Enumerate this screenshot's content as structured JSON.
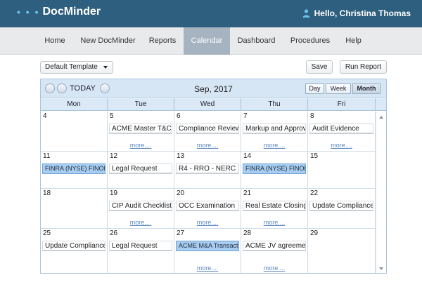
{
  "app": {
    "logo_dots": "• • •",
    "name": "DocMinder",
    "greeting": "Hello, Christina Thomas"
  },
  "nav": [
    "Home",
    "New DocMinder",
    "Reports",
    "Calendar",
    "Dashboard",
    "Procedures",
    "Help"
  ],
  "nav_active": "Calendar",
  "toolbar": {
    "template": "Default Template",
    "save": "Save",
    "run_report": "Run Report"
  },
  "calendar": {
    "today_label": "TODAY",
    "title": "Sep, 2017",
    "views": [
      "Day",
      "Week",
      "Month"
    ],
    "active_view": "Month",
    "weekdays": [
      "Mon",
      "Tue",
      "Wed",
      "Thu",
      "Fri"
    ],
    "more_label": "more....",
    "weeks": [
      [
        {
          "day": "4"
        },
        {
          "day": "5",
          "event": "ACME Master T&C",
          "more": true
        },
        {
          "day": "6",
          "event": "Compliance Review",
          "more": true
        },
        {
          "day": "7",
          "event": "Markup and Approval",
          "more": true
        },
        {
          "day": "8",
          "event": "Audit Evidence",
          "more": true
        }
      ],
      [
        {
          "day": "11",
          "event": "FINRA (NYSE) FINOP",
          "highlight": true
        },
        {
          "day": "12",
          "event": "Legal Request"
        },
        {
          "day": "13",
          "event": "R4 - RRO - NERC"
        },
        {
          "day": "14",
          "event": "FINRA (NYSE) FINOP",
          "highlight": true
        },
        {
          "day": "15"
        }
      ],
      [
        {
          "day": "18"
        },
        {
          "day": "19",
          "event": "CIP Audit Checklist",
          "more": true
        },
        {
          "day": "20",
          "event": "OCC Examination",
          "more": true
        },
        {
          "day": "21",
          "event": "Real Estate Closing",
          "more": true
        },
        {
          "day": "22",
          "event": "Update Compliance"
        }
      ],
      [
        {
          "day": "25",
          "event": "Update Compliance"
        },
        {
          "day": "26",
          "event": "Legal Request"
        },
        {
          "day": "27",
          "event": "ACME M&A Transaction",
          "highlight": true,
          "more": true
        },
        {
          "day": "28",
          "event": "ACME JV agreement",
          "more": true
        },
        {
          "day": "29"
        }
      ]
    ]
  },
  "colors": {
    "topbar": "#2e5f7e",
    "accent": "#6cc3ea",
    "highlight_event": "#a9cdf0",
    "link": "#5b86c0"
  }
}
